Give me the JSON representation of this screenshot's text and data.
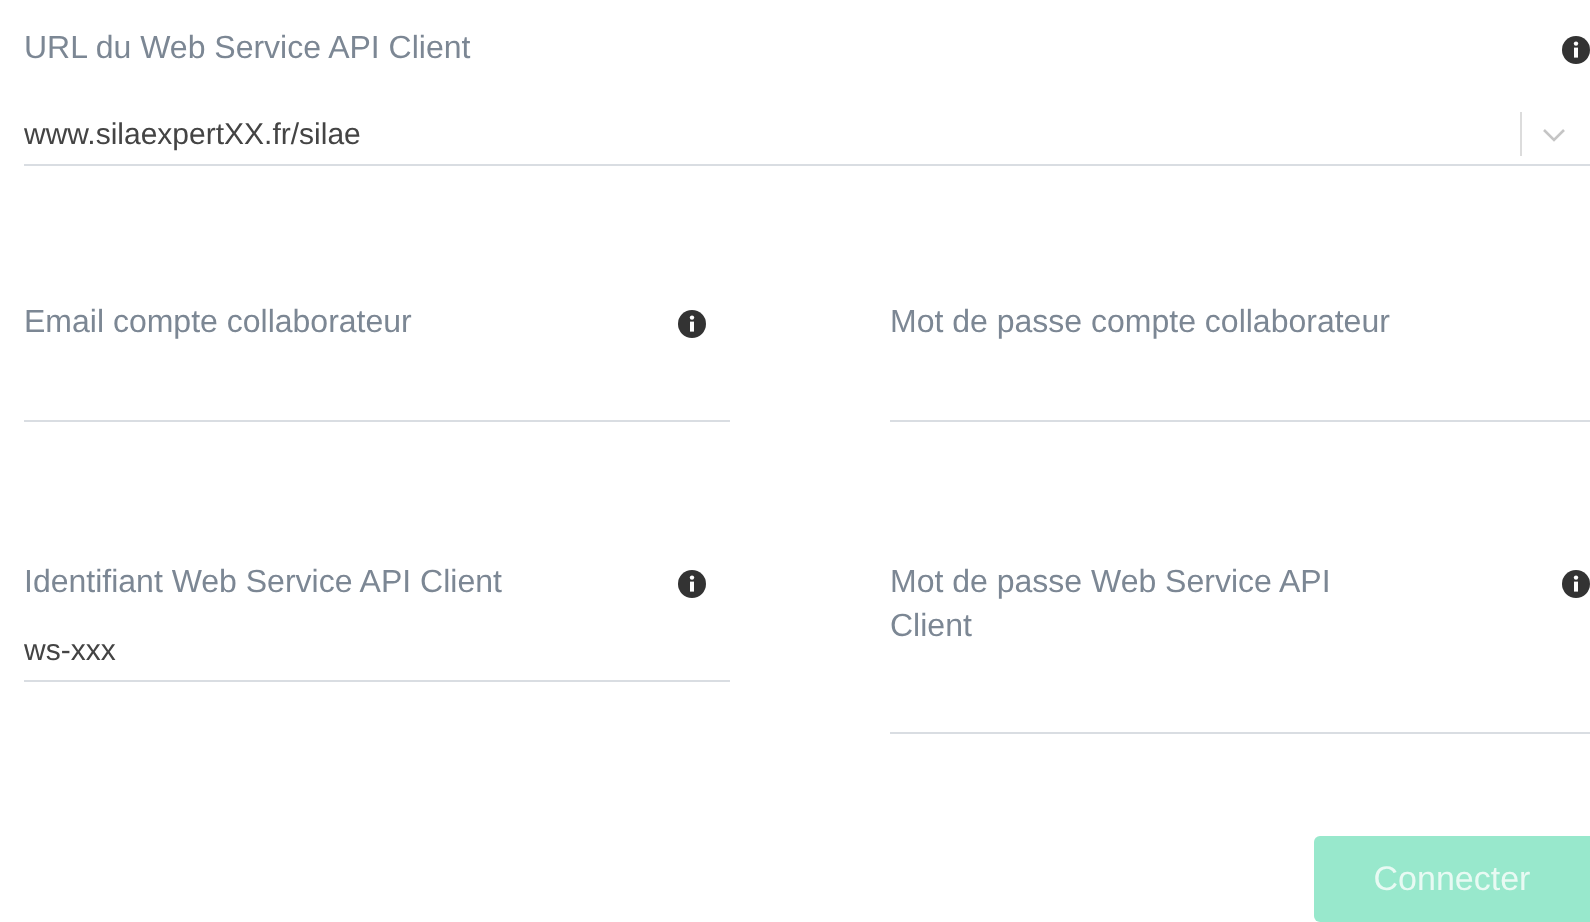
{
  "url_field": {
    "label": "URL du Web Service API Client",
    "value": "www.silaexpertXX.fr/silae",
    "info": true,
    "kind": "dropdown"
  },
  "fields": [
    {
      "label": "Email compte collaborateur",
      "info": true
    },
    {
      "label": "Mot de passe compte collaborateur",
      "info": false
    },
    {
      "label": "Identifiant Web Service API Client",
      "value": "ws-xxx",
      "info": true
    },
    {
      "label": "Mot de passe Web Service API Client",
      "info": true
    }
  ],
  "submit": {
    "label": "Connecter",
    "disabled": true
  }
}
